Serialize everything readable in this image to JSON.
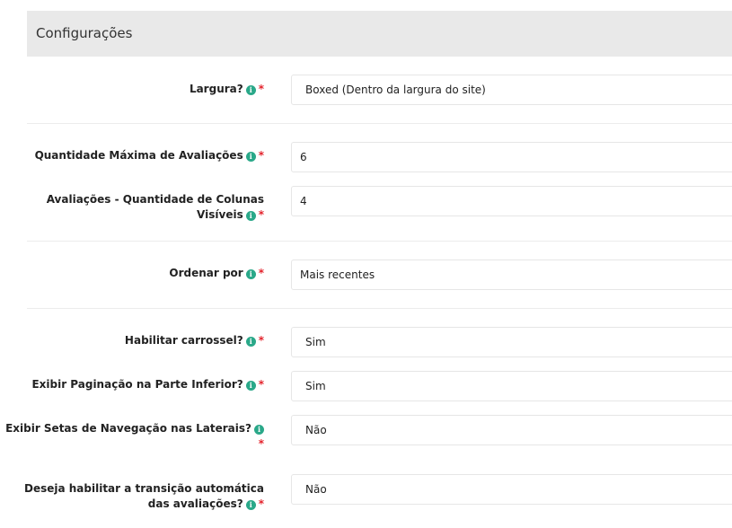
{
  "panel": {
    "title": "Configurações"
  },
  "required_mark": "*",
  "info_glyph": "i",
  "fields": {
    "largura": {
      "label": "Largura?",
      "value": "Boxed (Dentro da largura do site)"
    },
    "qtd_max": {
      "label": "Quantidade Máxima de Avaliações",
      "value": "6"
    },
    "colunas": {
      "label": "Avaliações - Quantidade de Colunas Visíveis",
      "value": "4"
    },
    "ordenar": {
      "label": "Ordenar por",
      "value": "Mais recentes"
    },
    "carrossel": {
      "label": "Habilitar carrossel?",
      "value": "Sim"
    },
    "paginacao": {
      "label": "Exibir Paginação na Parte Inferior?",
      "value": "Sim"
    },
    "setas": {
      "label": "Exibir Setas de Navegação nas Laterais?",
      "value": "Não"
    },
    "transicao": {
      "label": "Deseja habilitar a transição automática das avaliações?",
      "value": "Não"
    }
  }
}
